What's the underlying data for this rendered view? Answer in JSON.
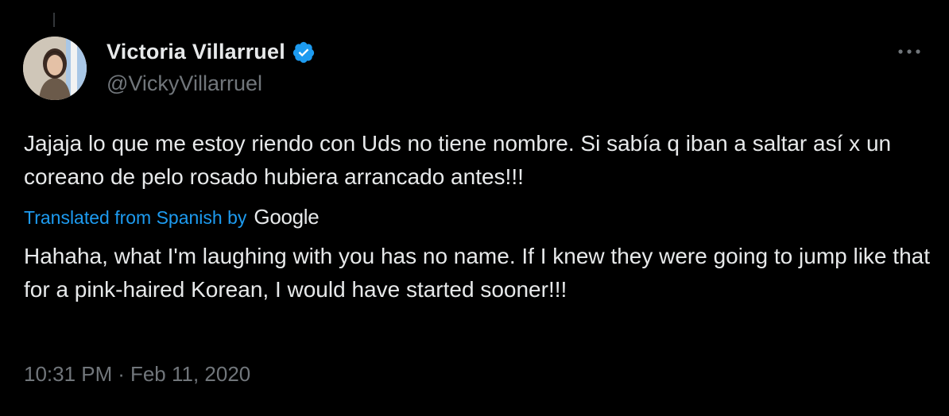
{
  "tweet": {
    "author": {
      "display_name": "Victoria Villarruel",
      "handle": "@VickyVillarruel",
      "verified": true,
      "avatar_icon": "profile-photo"
    },
    "original_text": "Jajaja lo que me estoy riendo con Uds no tiene nombre. Si sabía q iban a saltar así x un coreano de pelo rosado hubiera arrancado antes!!!",
    "translation_label": "Translated from Spanish by",
    "translation_provider": "Google",
    "translated_text": "Hahaha, what I'm laughing with you has no name. If I knew they were going to jump like that for a pink-haired Korean, I would have started sooner!!!",
    "time": "10:31 PM",
    "separator": "·",
    "date": "Feb 11, 2020",
    "more_icon": "more-horizontal-icon"
  },
  "colors": {
    "background": "#000000",
    "text_primary": "#e7e9ea",
    "text_secondary": "#71767b",
    "accent": "#1d9bf0"
  }
}
